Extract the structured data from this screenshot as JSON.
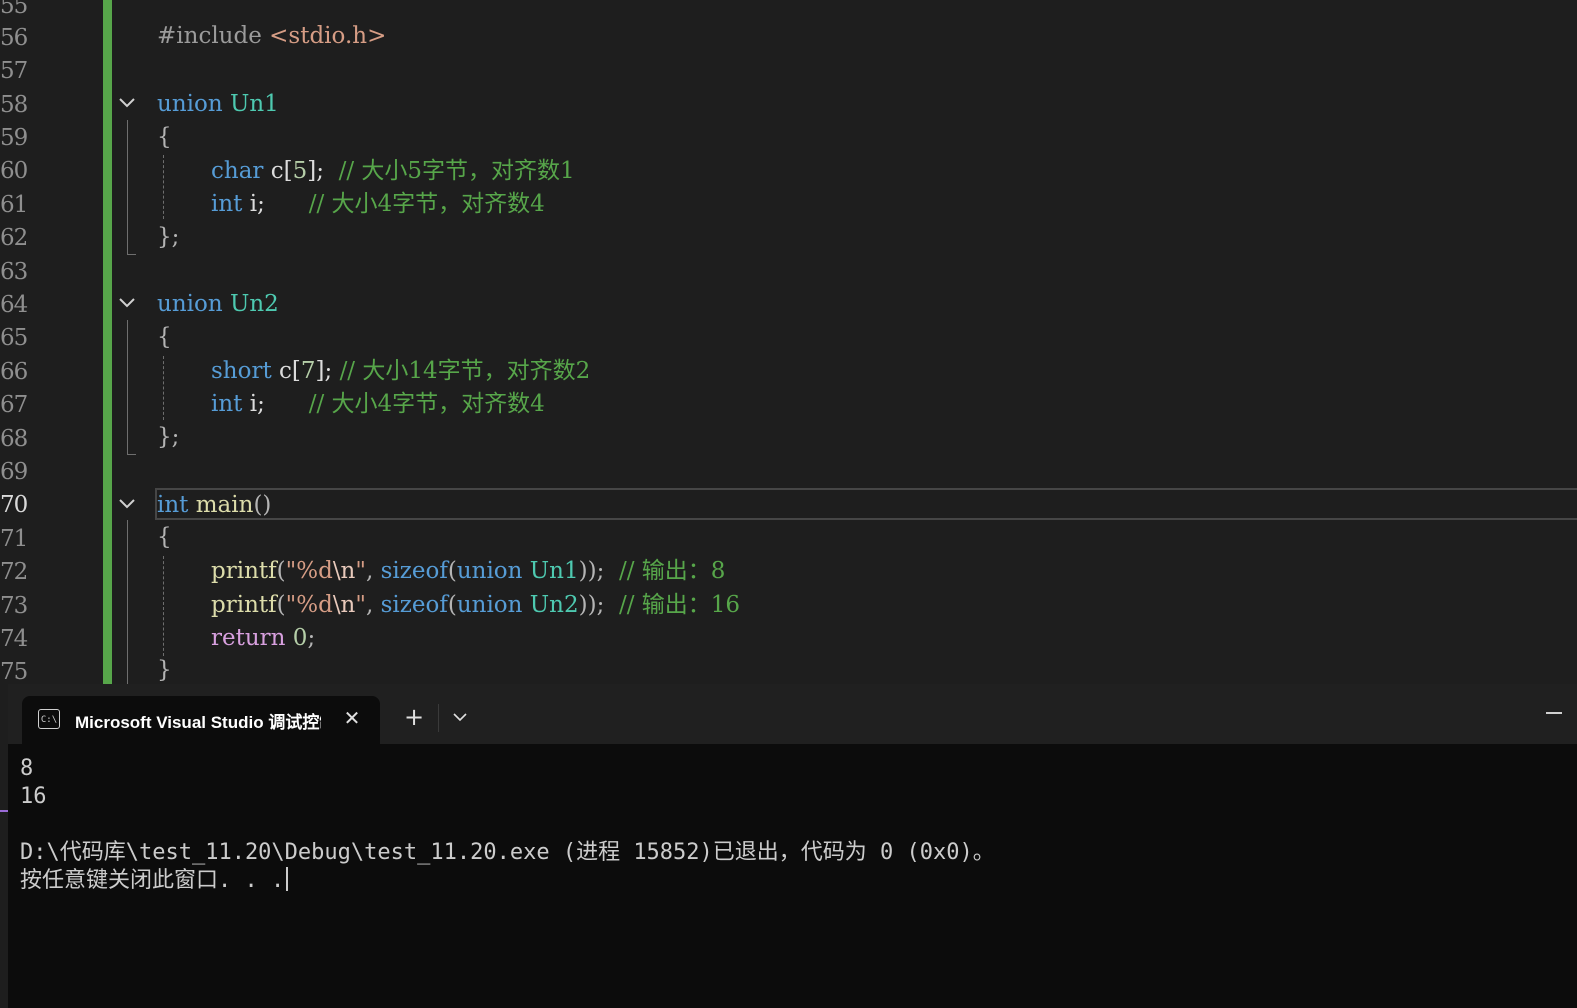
{
  "editor": {
    "line_numbers": [
      "55",
      "56",
      "57",
      "58",
      "59",
      "60",
      "61",
      "62",
      "63",
      "64",
      "65",
      "66",
      "67",
      "68",
      "69",
      "70",
      "71",
      "72",
      "73",
      "74",
      "75"
    ],
    "current_line": "70",
    "lines": {
      "l56": {
        "hash": "#include ",
        "inc": "<stdio.h>"
      },
      "l58": {
        "kw": "union",
        "sp": " ",
        "ty": "Un1"
      },
      "l59": {
        "t": "{"
      },
      "l60": {
        "kw": "char",
        "code": " c[",
        "num": "5",
        "code2": "];  ",
        "cm": "// 大小5字节，对齐数1"
      },
      "l61": {
        "kw": "int",
        "code": " i;      ",
        "cm": "// 大小4字节，对齐数4"
      },
      "l62": {
        "t": "};"
      },
      "l64": {
        "kw": "union",
        "sp": " ",
        "ty": "Un2"
      },
      "l65": {
        "t": "{"
      },
      "l66": {
        "kw": "short",
        "code": " c[",
        "num": "7",
        "code2": "]; ",
        "cm": "// 大小14字节，对齐数2"
      },
      "l67": {
        "kw": "int",
        "code": " i;      ",
        "cm": "// 大小4字节，对齐数4"
      },
      "l68": {
        "t": "};"
      },
      "l70": {
        "kw": "int",
        "sp": " ",
        "fn": "main",
        "code": "()"
      },
      "l71": {
        "t": "{"
      },
      "l72": {
        "fn": "printf",
        "p1": "(",
        "s1": "\"%d",
        "esc": "\\n",
        "s2": "\"",
        "p2": ", ",
        "kw1": "sizeof",
        "p3": "(",
        "kw2": "union",
        "sp": " ",
        "ty": "Un1",
        "p4": "));  ",
        "cm": "// 输出：8"
      },
      "l73": {
        "fn": "printf",
        "p1": "(",
        "s1": "\"%d",
        "esc": "\\n",
        "s2": "\"",
        "p2": ", ",
        "kw1": "sizeof",
        "p3": "(",
        "kw2": "union",
        "sp": " ",
        "ty": "Un2",
        "p4": "));  ",
        "cm": "// 输出：16"
      },
      "l74": {
        "ctl": "return",
        "sp": " ",
        "num": "0",
        "code": ";"
      },
      "l75": {
        "t": "}"
      }
    }
  },
  "terminal": {
    "tab_title": "Microsoft Visual Studio 调试控制台",
    "tab_icon_text": "C:\\",
    "close_glyph": "✕",
    "new_tab_glyph": "+",
    "output": [
      "8",
      "16",
      "",
      "D:\\代码库\\test_11.20\\Debug\\test_11.20.exe (进程 15852)已退出，代码为 0 (0x0)。",
      "按任意键关闭此窗口. . ."
    ]
  },
  "colors": {
    "editor_bg": "#1e1e1e",
    "terminal_bg": "#0c0c0c",
    "change_bar": "#57a64a",
    "keyword": "#569cd6",
    "type": "#4ec9b0",
    "comment": "#57a64a",
    "function": "#dcdcaa",
    "string": "#d69d85"
  }
}
